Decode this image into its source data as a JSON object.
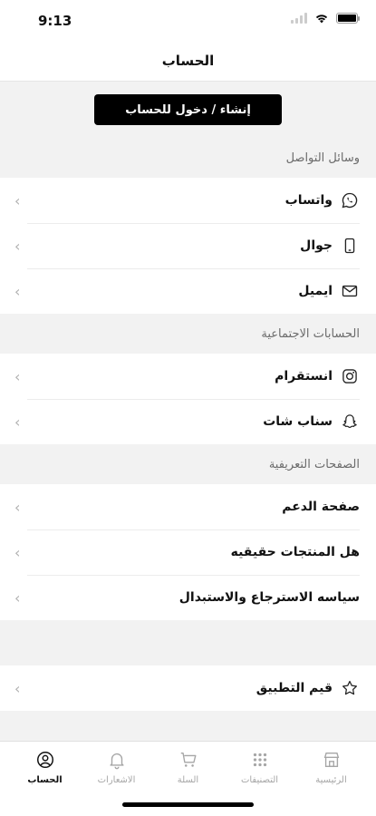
{
  "status_bar": {
    "time": "9:13"
  },
  "header": {
    "title": "الحساب"
  },
  "login_button_label": "إنشاء / دخول للحساب",
  "sections": {
    "contact": {
      "title": "وسائل التواصل",
      "items": [
        {
          "label": "واتساب",
          "icon": "whatsapp-icon"
        },
        {
          "label": "جوال",
          "icon": "mobile-icon"
        },
        {
          "label": "ايميل",
          "icon": "mail-icon"
        }
      ]
    },
    "social": {
      "title": "الحسابات الاجتماعية",
      "items": [
        {
          "label": "انستقرام",
          "icon": "instagram-icon"
        },
        {
          "label": "سناب شات",
          "icon": "snapchat-icon"
        }
      ]
    },
    "pages": {
      "title": "الصفحات التعريفية",
      "items": [
        {
          "label": "صفحة الدعم"
        },
        {
          "label": "هل المنتجات حقيقيه"
        },
        {
          "label": "سياسه الاسترجاع والاستبدال"
        }
      ]
    },
    "rate": {
      "label": "قيم التطبيق",
      "icon": "star-icon"
    }
  },
  "tabs": [
    {
      "label": "الرئيسية",
      "icon": "store-icon"
    },
    {
      "label": "التصنيفات",
      "icon": "grid-icon"
    },
    {
      "label": "السلة",
      "icon": "cart-icon"
    },
    {
      "label": "الاشعارات",
      "icon": "bell-icon"
    },
    {
      "label": "الحساب",
      "icon": "account-icon",
      "active": true
    }
  ],
  "colors": {
    "primary": "#000000",
    "section_bg": "#f2f2f2",
    "inactive": "#a6a6a6"
  }
}
